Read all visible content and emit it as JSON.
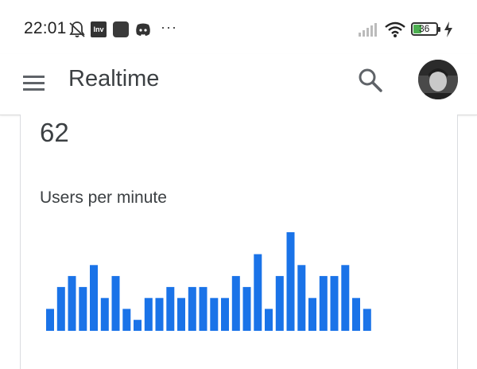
{
  "status_bar": {
    "time": "22:01",
    "app_badge_text": "Inv",
    "battery": "36",
    "more_dots": "···",
    "icons": [
      "mute-bell-icon",
      "inv-app-icon",
      "square-app-icon",
      "discord-icon",
      "more-dots-icon",
      "signal-icon",
      "wifi-icon",
      "battery-icon",
      "charging-icon"
    ]
  },
  "app_bar": {
    "title": "Realtime",
    "icons": [
      "menu-icon",
      "search-icon",
      "avatar"
    ]
  },
  "card": {
    "active_users_value": "62",
    "chart_label": "Users per minute"
  },
  "colors": {
    "bar": "#1a73e8",
    "text": "#3c4043",
    "divider": "#dadce0"
  },
  "chart_data": {
    "type": "bar",
    "title": "Users per minute",
    "values": [
      2,
      4,
      5,
      4,
      6,
      3,
      5,
      2,
      1,
      3,
      3,
      4,
      3,
      4,
      4,
      3,
      3,
      5,
      4,
      7,
      2,
      5,
      9,
      6,
      3,
      5,
      5,
      6,
      3,
      2
    ],
    "ylim": [
      0,
      9
    ]
  }
}
